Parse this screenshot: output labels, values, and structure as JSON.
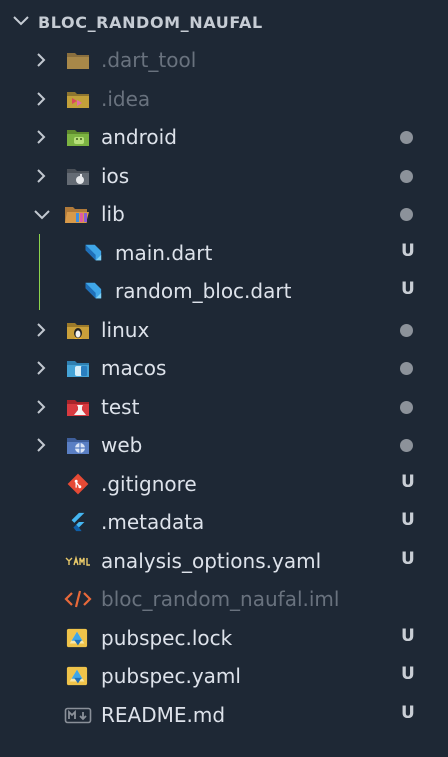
{
  "explorer": {
    "section_title": "BLOC_RANDOM_NAUFAL",
    "items": [
      {
        "label": ".dart_tool",
        "icon": "folder-icon",
        "status": ""
      },
      {
        "label": ".idea",
        "icon": "idea-folder-icon",
        "status": ""
      },
      {
        "label": "android",
        "icon": "android-folder-icon",
        "status": "dot"
      },
      {
        "label": "ios",
        "icon": "ios-folder-icon",
        "status": "dot"
      },
      {
        "label": "lib",
        "icon": "lib-folder-open-icon",
        "status": "dot"
      },
      {
        "label": "main.dart",
        "icon": "dart-icon",
        "status": "U"
      },
      {
        "label": "random_bloc.dart",
        "icon": "dart-icon",
        "status": "U"
      },
      {
        "label": "linux",
        "icon": "linux-folder-icon",
        "status": "dot"
      },
      {
        "label": "macos",
        "icon": "macos-folder-icon",
        "status": "dot"
      },
      {
        "label": "test",
        "icon": "test-folder-icon",
        "status": "dot"
      },
      {
        "label": "web",
        "icon": "web-folder-icon",
        "status": "dot"
      },
      {
        "label": ".gitignore",
        "icon": "git-icon",
        "status": "U"
      },
      {
        "label": ".metadata",
        "icon": "flutter-icon",
        "status": "U"
      },
      {
        "label": "analysis_options.yaml",
        "icon": "yaml-icon",
        "status": "U"
      },
      {
        "label": "bloc_random_naufal.iml",
        "icon": "code-icon",
        "status": ""
      },
      {
        "label": "pubspec.lock",
        "icon": "pubspec-icon",
        "status": "U"
      },
      {
        "label": "pubspec.yaml",
        "icon": "pubspec-icon",
        "status": "U"
      },
      {
        "label": "README.md",
        "icon": "markdown-icon",
        "status": "U"
      }
    ]
  },
  "colors": {
    "background": "#1e2835",
    "text": "#dde2ea",
    "dimmed_text": "#69727e",
    "modified_dot": "#8c929a",
    "untracked_badge": "#c9ced5",
    "indent_guide": "#8bd44d"
  }
}
